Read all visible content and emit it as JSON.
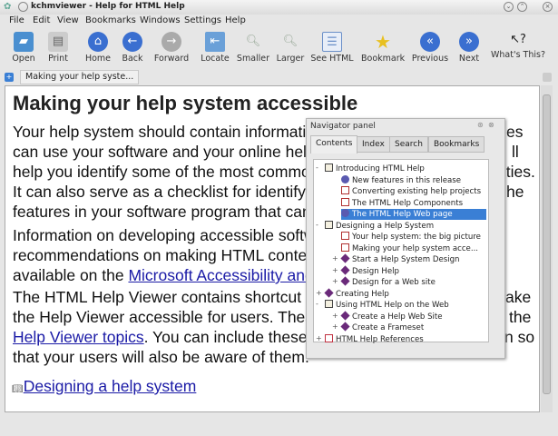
{
  "window": {
    "title": "kchmviewer - Help for HTML Help"
  },
  "menu": [
    "File",
    "Edit",
    "View",
    "Bookmarks",
    "Windows",
    "Settings",
    "Help"
  ],
  "toolbar": [
    {
      "label": "Open",
      "icon": "folder-open-icon"
    },
    {
      "label": "Print",
      "icon": "printer-icon"
    },
    {
      "label": "Home",
      "icon": "home-icon"
    },
    {
      "label": "Back",
      "icon": "arrow-left-icon"
    },
    {
      "label": "Forward",
      "icon": "arrow-right-icon"
    },
    {
      "label": "Locate",
      "icon": "locate-icon"
    },
    {
      "label": "Smaller",
      "icon": "zoom-out-icon"
    },
    {
      "label": "Larger",
      "icon": "zoom-in-icon"
    },
    {
      "label": "See HTML",
      "icon": "html-source-icon"
    },
    {
      "label": "Bookmark",
      "icon": "star-bookmark-icon"
    },
    {
      "label": "Previous",
      "icon": "previous-icon"
    },
    {
      "label": "Next",
      "icon": "next-icon"
    },
    {
      "label": "What's This?",
      "icon": "whats-this-icon"
    }
  ],
  "tab": {
    "label": "Making your help syste..."
  },
  "page": {
    "title": "Making your help system accessible",
    "lines": [
      {
        "left": "Your help system should contain informatio",
        "right": "es"
      },
      {
        "left": "can use your software and your online help.",
        "right": "ll"
      },
      {
        "left": "help you identify some of the most common",
        "right": "lities."
      },
      {
        "left": "It can also serve as a checklist for identifyin",
        "right": "he"
      },
      {
        "left": "features in your software program that can h",
        "right": ""
      },
      {
        "left": "Information on developing accessible softw",
        "right": ""
      },
      {
        "left": "recommendations on making HTML content",
        "right": ""
      },
      {
        "pre": "available on the ",
        "link": "Microsoft Accessibility and",
        "right": ""
      },
      {
        "left": "The HTML Help Viewer contains shortcut ke",
        "right": "ake"
      },
      {
        "left": "the Help Viewer accessible for users. These",
        "right": "the"
      },
      {
        "link": "Help Viewer topics",
        "post": ". You can include these t",
        "right": "n so"
      },
      {
        "left": "that your users will also be aware of them.",
        "right": ""
      }
    ],
    "footer_link": "Designing a help system"
  },
  "navigator": {
    "title": "Navigator panel",
    "tabs": [
      "Contents",
      "Index",
      "Search",
      "Bookmarks"
    ],
    "active_tab": "Contents",
    "tree": [
      {
        "label": "Introducing HTML Help",
        "level": 0,
        "type": "book-open",
        "exp": "-"
      },
      {
        "label": "New features in this release",
        "level": 1,
        "type": "page-web"
      },
      {
        "label": "Converting existing help projects",
        "level": 1,
        "type": "page"
      },
      {
        "label": "The HTML Help Components",
        "level": 1,
        "type": "page"
      },
      {
        "label": "The HTML Help Web page",
        "level": 1,
        "type": "page-web",
        "selected": true
      },
      {
        "label": "Designing a Help System",
        "level": 0,
        "type": "book-open",
        "exp": "-"
      },
      {
        "label": "Your help system: the big picture",
        "level": 1,
        "type": "page"
      },
      {
        "label": "Making your help system acce...",
        "level": 1,
        "type": "page"
      },
      {
        "label": "Start a Help System Design",
        "level": 1,
        "type": "book",
        "exp": "+"
      },
      {
        "label": "Design Help",
        "level": 1,
        "type": "book",
        "exp": "+"
      },
      {
        "label": "Design for a Web site",
        "level": 1,
        "type": "book",
        "exp": "+"
      },
      {
        "label": "Creating Help",
        "level": 0,
        "type": "book",
        "exp": "+"
      },
      {
        "label": "Using HTML Help on the Web",
        "level": 0,
        "type": "book-open",
        "exp": "-"
      },
      {
        "label": "Create a Help Web Site",
        "level": 1,
        "type": "book",
        "exp": "+"
      },
      {
        "label": "Create a Frameset",
        "level": 1,
        "type": "book",
        "exp": "+"
      },
      {
        "label": "HTML Help References",
        "level": 0,
        "type": "book-red",
        "exp": "+"
      }
    ]
  },
  "colors": {
    "selection": "#3a7fd5",
    "link": "#1a1aa6",
    "book": "#6a2a7a"
  }
}
